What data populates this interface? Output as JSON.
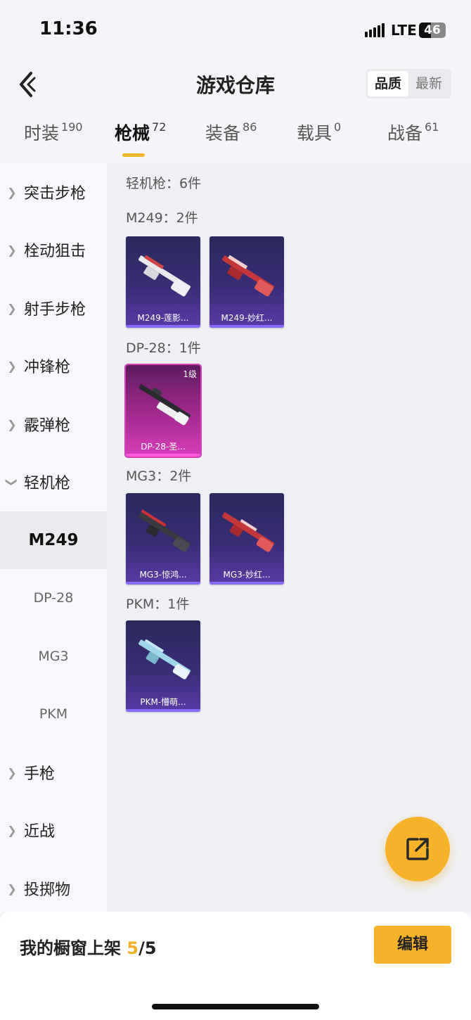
{
  "status_bar": {
    "time": "11:36",
    "network": "LTE",
    "battery": "46",
    "battery_fraction": 0.46
  },
  "header": {
    "title": "游戏仓库",
    "sort": {
      "quality": "品质",
      "newest": "最新"
    }
  },
  "tabs": [
    {
      "label": "时装",
      "count": "190"
    },
    {
      "label": "枪械",
      "count": "72"
    },
    {
      "label": "装备",
      "count": "86"
    },
    {
      "label": "载具",
      "count": "0"
    },
    {
      "label": "战备",
      "count": "61"
    }
  ],
  "sidebar": {
    "categories": [
      "突击步枪",
      "栓动狙击",
      "射手步枪",
      "冲锋枪",
      "霰弹枪",
      "轻机枪",
      "手枪",
      "近战",
      "投掷物"
    ],
    "subcategories": [
      "M249",
      "DP-28",
      "MG3",
      "PKM"
    ]
  },
  "content": {
    "category_summary": "轻机枪：6件",
    "groups": [
      {
        "heading": "M249：2件",
        "items": [
          {
            "name": "M249-莲影...",
            "rarity": "purple"
          },
          {
            "name": "M249-妙红...",
            "rarity": "purple"
          }
        ]
      },
      {
        "heading": "DP-28：1件",
        "items": [
          {
            "name": "DP-28-圣...",
            "rarity": "pink",
            "level": "1级"
          }
        ]
      },
      {
        "heading": "MG3：2件",
        "items": [
          {
            "name": "MG3-惊鸿...",
            "rarity": "purple"
          },
          {
            "name": "MG3-妙红...",
            "rarity": "purple"
          }
        ]
      },
      {
        "heading": "PKM：1件",
        "items": [
          {
            "name": "PKM-懵萌...",
            "rarity": "purple"
          }
        ]
      }
    ]
  },
  "bottom_bar": {
    "label": "我的橱窗上架",
    "shelved": "5",
    "separator": "/",
    "total": "5",
    "edit_button": "编辑"
  },
  "colors": {
    "accent": "#f6b32a",
    "purple_card": "#3a2c76",
    "pink_card": "#a52a8f"
  },
  "icons": {
    "back": "chevron-left-icon",
    "share": "share-out-icon"
  }
}
